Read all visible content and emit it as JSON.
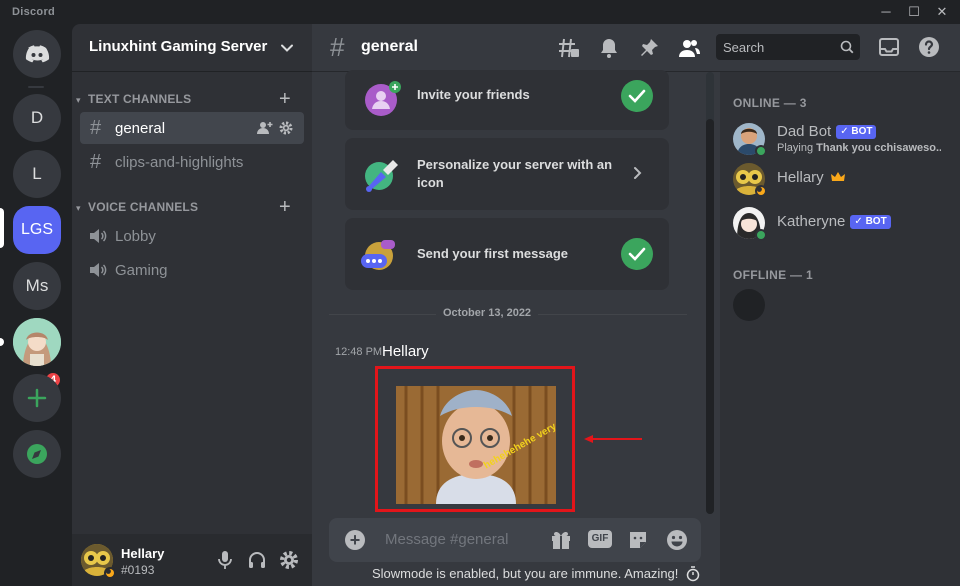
{
  "app": {
    "title": "Discord"
  },
  "window_controls": {
    "minimize": "─",
    "maximize": "☐",
    "close": "✕"
  },
  "servers": [
    {
      "label": "D"
    },
    {
      "label": "L"
    },
    {
      "label": "LGS",
      "active": true
    },
    {
      "label": "Ms"
    }
  ],
  "server_badge": "4",
  "guild": {
    "name": "Linuxhint Gaming Server"
  },
  "categories": {
    "text": "Text Channels",
    "voice": "Voice Channels"
  },
  "text_channels": [
    {
      "name": "general",
      "selected": true
    },
    {
      "name": "clips-and-highlights"
    }
  ],
  "voice_channels": [
    {
      "name": "Lobby"
    },
    {
      "name": "Gaming"
    }
  ],
  "user": {
    "name": "Hellary",
    "tag": "#0193"
  },
  "channel": {
    "title": "general"
  },
  "search": {
    "placeholder": "Search"
  },
  "onboarding": [
    {
      "text": "Invite your friends",
      "done": true
    },
    {
      "text": "Personalize your server with an icon",
      "done": false
    },
    {
      "text": "Send your first message",
      "done": true
    }
  ],
  "date_divider": "October 13, 2022",
  "message": {
    "time": "12:48 PM",
    "author": "Hellary",
    "image_caption": "hehehehehe very funny"
  },
  "composer": {
    "placeholder": "Message #general",
    "gif_label": "GIF"
  },
  "slowmode": "Slowmode is enabled, but you are immune. Amazing!",
  "members": {
    "online_header": "Online — 3",
    "offline_header": "Offline — 1",
    "online": [
      {
        "name": "Dad Bot",
        "bot": "BOT",
        "activity_prefix": "Playing",
        "activity": "Thank you cchisaweso..."
      },
      {
        "name": "Hellary",
        "owner": true
      },
      {
        "name": "Katheryne",
        "bot": "BOT"
      }
    ]
  },
  "colors": {
    "blurple": "#5865f2",
    "green": "#3ba55d",
    "red_annotation": "#e3151a"
  }
}
